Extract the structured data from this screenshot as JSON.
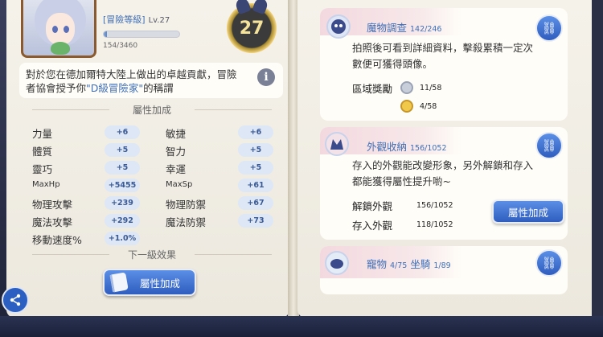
{
  "left_page": {
    "rank_title": "[冒險等級]",
    "rank_level": "Lv.27",
    "xp_text": "154/3460",
    "xp_fraction": 0.045,
    "level_badge": "27",
    "honor_line1_a": "對於您在德加爾特大陸上做出的卓越貢獻，冒險",
    "honor_line2_a": "者協會授予你",
    "honor_line2_hl": "\"D級冒險家\"",
    "honor_line2_b": "的稱謂",
    "section_attr": "屬性加成",
    "section_next": "下一級效果",
    "stats": [
      {
        "label": "力量",
        "value": "+6"
      },
      {
        "label": "敏捷",
        "value": "+6"
      },
      {
        "label": "體質",
        "value": "+5"
      },
      {
        "label": "智力",
        "value": "+5"
      },
      {
        "label": "靈巧",
        "value": "+5"
      },
      {
        "label": "幸運",
        "value": "+5"
      },
      {
        "label": "MaxHp",
        "value": "+5455"
      },
      {
        "label": "MaxSp",
        "value": "+61"
      },
      {
        "label": "物理攻擊",
        "value": "+239"
      },
      {
        "label": "物理防禦",
        "value": "+67"
      },
      {
        "label": "魔法攻擊",
        "value": "+292"
      },
      {
        "label": "魔法防禦",
        "value": "+73"
      },
      {
        "label": "移動速度%",
        "value": "+1.0%"
      }
    ],
    "bonus_button": "屬性加成"
  },
  "right_page": {
    "monster": {
      "title": "魔物調查",
      "count": "142/246",
      "desc1": "拍照後可看到詳細資料，擊殺累積一定次",
      "desc2": "數便可獲得頭像。",
      "reward_label": "區域獎勵",
      "reward1": "11/58",
      "reward2": "4/58"
    },
    "appearance": {
      "title": "外觀收納",
      "count": "156/1052",
      "desc1": "存入的外觀能改變形象，另外解鎖和存入",
      "desc2": "都能獲得屬性提升喲~",
      "unlock_label": "解鎖外觀",
      "unlock_value": "156/1052",
      "stored_label": "存入外觀",
      "stored_value": "118/1052",
      "bonus_button": "屬性加成"
    },
    "pet": {
      "title": "寵物",
      "count": "4/75",
      "title2": "坐騎",
      "count2": "1/89"
    }
  },
  "colors": {
    "accent": "#3f6fb6",
    "button": "#2f5dbf",
    "page": "#f3f0e8"
  }
}
